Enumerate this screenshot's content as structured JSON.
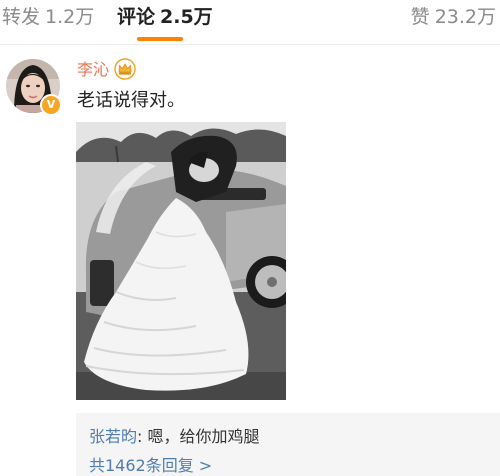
{
  "tabs": {
    "repost": {
      "label": "转发",
      "count": "1.2万"
    },
    "comment": {
      "label": "评论",
      "count": "2.5万"
    },
    "like": {
      "label": "赞",
      "count": "23.2万"
    }
  },
  "colors": {
    "accent": "#ff8200",
    "username": "#eb7350",
    "link": "#507daf"
  },
  "comment": {
    "username": "李沁",
    "badge_icon": "crown-icon",
    "verified_icon": "verified-badge-icon",
    "text": "老话说得对。"
  },
  "replies": {
    "first": {
      "author": "张若昀",
      "separator": ": ",
      "text": "嗯，给你加鸡腿"
    },
    "total_label": "共1462条回复 >"
  }
}
